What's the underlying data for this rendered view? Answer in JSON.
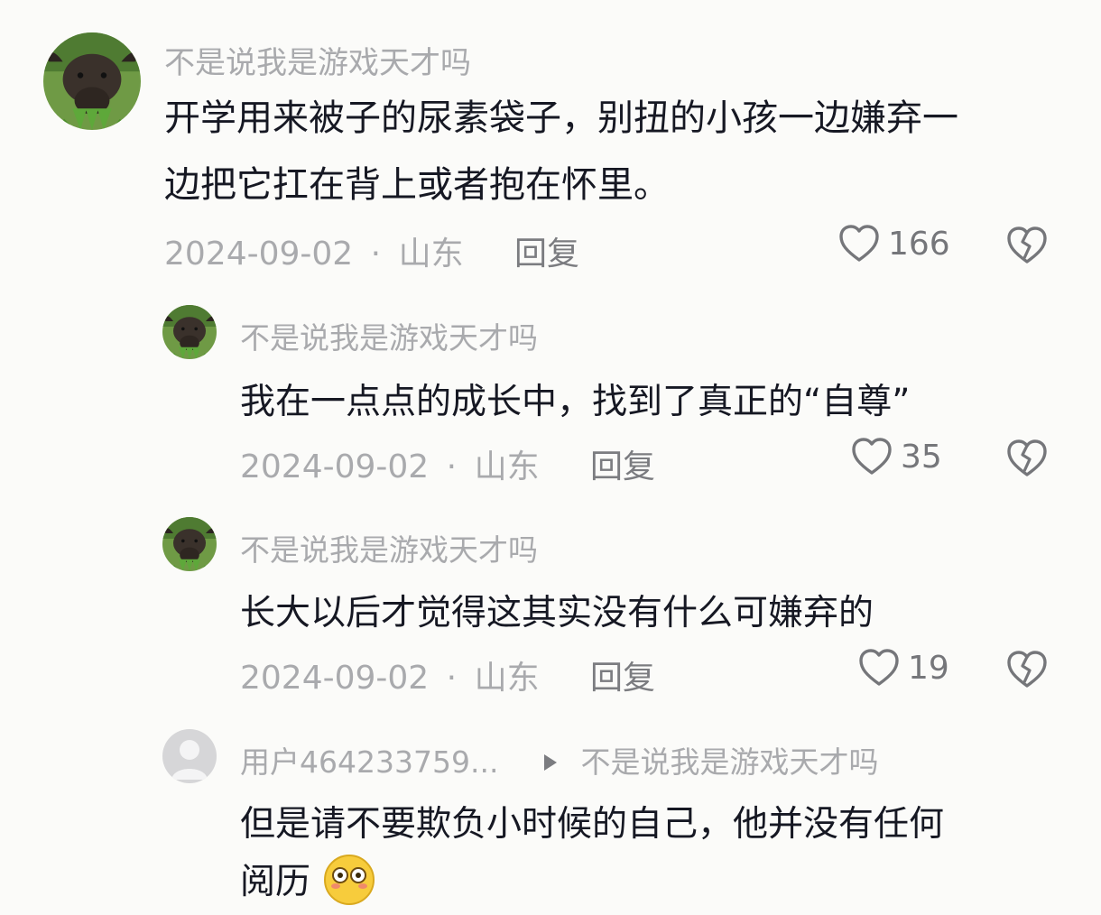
{
  "comments": [
    {
      "username": "不是说我是游戏天才吗",
      "text_line1": "开学用来被子的尿素袋子，别扭的小孩一边嫌弃一",
      "text_line2": "边把它扛在背上或者抱在怀里。",
      "date": "2024-09-02",
      "location": "山东",
      "reply_label": "回复",
      "likes": "166",
      "avatar_icon": "water-buffalo-avatar"
    }
  ],
  "replies": [
    {
      "username": "不是说我是游戏天才吗",
      "text": "我在一点点的成长中，找到了真正的“自尊”",
      "date": "2024-09-02",
      "location": "山东",
      "reply_label": "回复",
      "likes": "35",
      "avatar_icon": "water-buffalo-avatar"
    },
    {
      "username": "不是说我是游戏天才吗",
      "text": "长大以后才觉得这其实没有什么可嫌弃的",
      "date": "2024-09-02",
      "location": "山东",
      "reply_label": "回复",
      "likes": "19",
      "avatar_icon": "water-buffalo-avatar"
    },
    {
      "username": "用户464233759...",
      "reply_to": "不是说我是游戏天才吗",
      "text_line1": "但是请不要欺负小时候的自己，他并没有任何",
      "text_line2_partial": "阅历",
      "avatar_icon": "default-user-avatar",
      "emoji_icon": "flushed-face-emoji"
    }
  ],
  "separator": "·",
  "colors": {
    "background": "#fbfbf9",
    "text": "#161823",
    "secondary": "#a9aaad",
    "reply": "#7b7c80"
  }
}
